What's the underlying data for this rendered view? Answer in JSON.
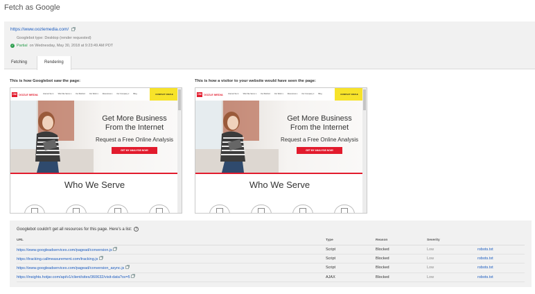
{
  "page": {
    "title": "Fetch as Google"
  },
  "summary": {
    "url": "https://www.oozlemedia.com/",
    "bot_type": "Googlebot type: Desktop (render requested)",
    "status": "Partial",
    "status_suffix": "on Wednesday, May 30, 2018 at 9:23:49 AM PDT"
  },
  "tabs": [
    {
      "label": "Fetching",
      "active": false
    },
    {
      "label": "Rendering",
      "active": true
    }
  ],
  "panels": {
    "googlebot_label": "This is how Googlebot saw the page:",
    "visitor_label": "This is how a visitor to your website would have seen the page:"
  },
  "preview": {
    "logo_mark": "OM",
    "logo_text": "OOZLE MEDIA",
    "nav": [
      "Internet Ser ▾",
      "Who We Serve ▾",
      "Our Method",
      "Our Work ▾",
      "Resources ▾",
      "Our Company ▾",
      "Blog"
    ],
    "contact": "CONTACT OOZLE",
    "headline": "Get More Business From the Internet",
    "subhead": "Request a Free Online Analysis",
    "cta": "GET MY ANALYSIS NOW!",
    "section_title": "Who We Serve"
  },
  "resources": {
    "heading": "Googlebot couldn't get all resources for this page. Here's a list:",
    "help_icon": "?",
    "columns": [
      "URL",
      "Type",
      "Reason",
      "Severity",
      ""
    ],
    "rows": [
      {
        "url": "https://www.googleadservices.com/pagead/conversion.js",
        "type": "Script",
        "reason": "Blocked",
        "severity": "Low",
        "link": "robots.txt"
      },
      {
        "url": "https://tracking.callmeasurement.com/tracking.js",
        "type": "Script",
        "reason": "Blocked",
        "severity": "Low",
        "link": "robots.txt"
      },
      {
        "url": "https://www.googleadservices.com/pagead/conversion_async.js",
        "type": "Script",
        "reason": "Blocked",
        "severity": "Low",
        "link": "robots.txt"
      },
      {
        "url": "https://insights.hotjar.com/api/v1/client/sites/360632/visit-data?sv=5",
        "type": "AJAX",
        "reason": "Blocked",
        "severity": "Low",
        "link": "robots.txt"
      }
    ]
  },
  "colors": {
    "link": "#1a5bbf",
    "success": "#2a9d4c",
    "brand_red": "#e21b2d",
    "contact_yellow": "#f7e32a"
  }
}
